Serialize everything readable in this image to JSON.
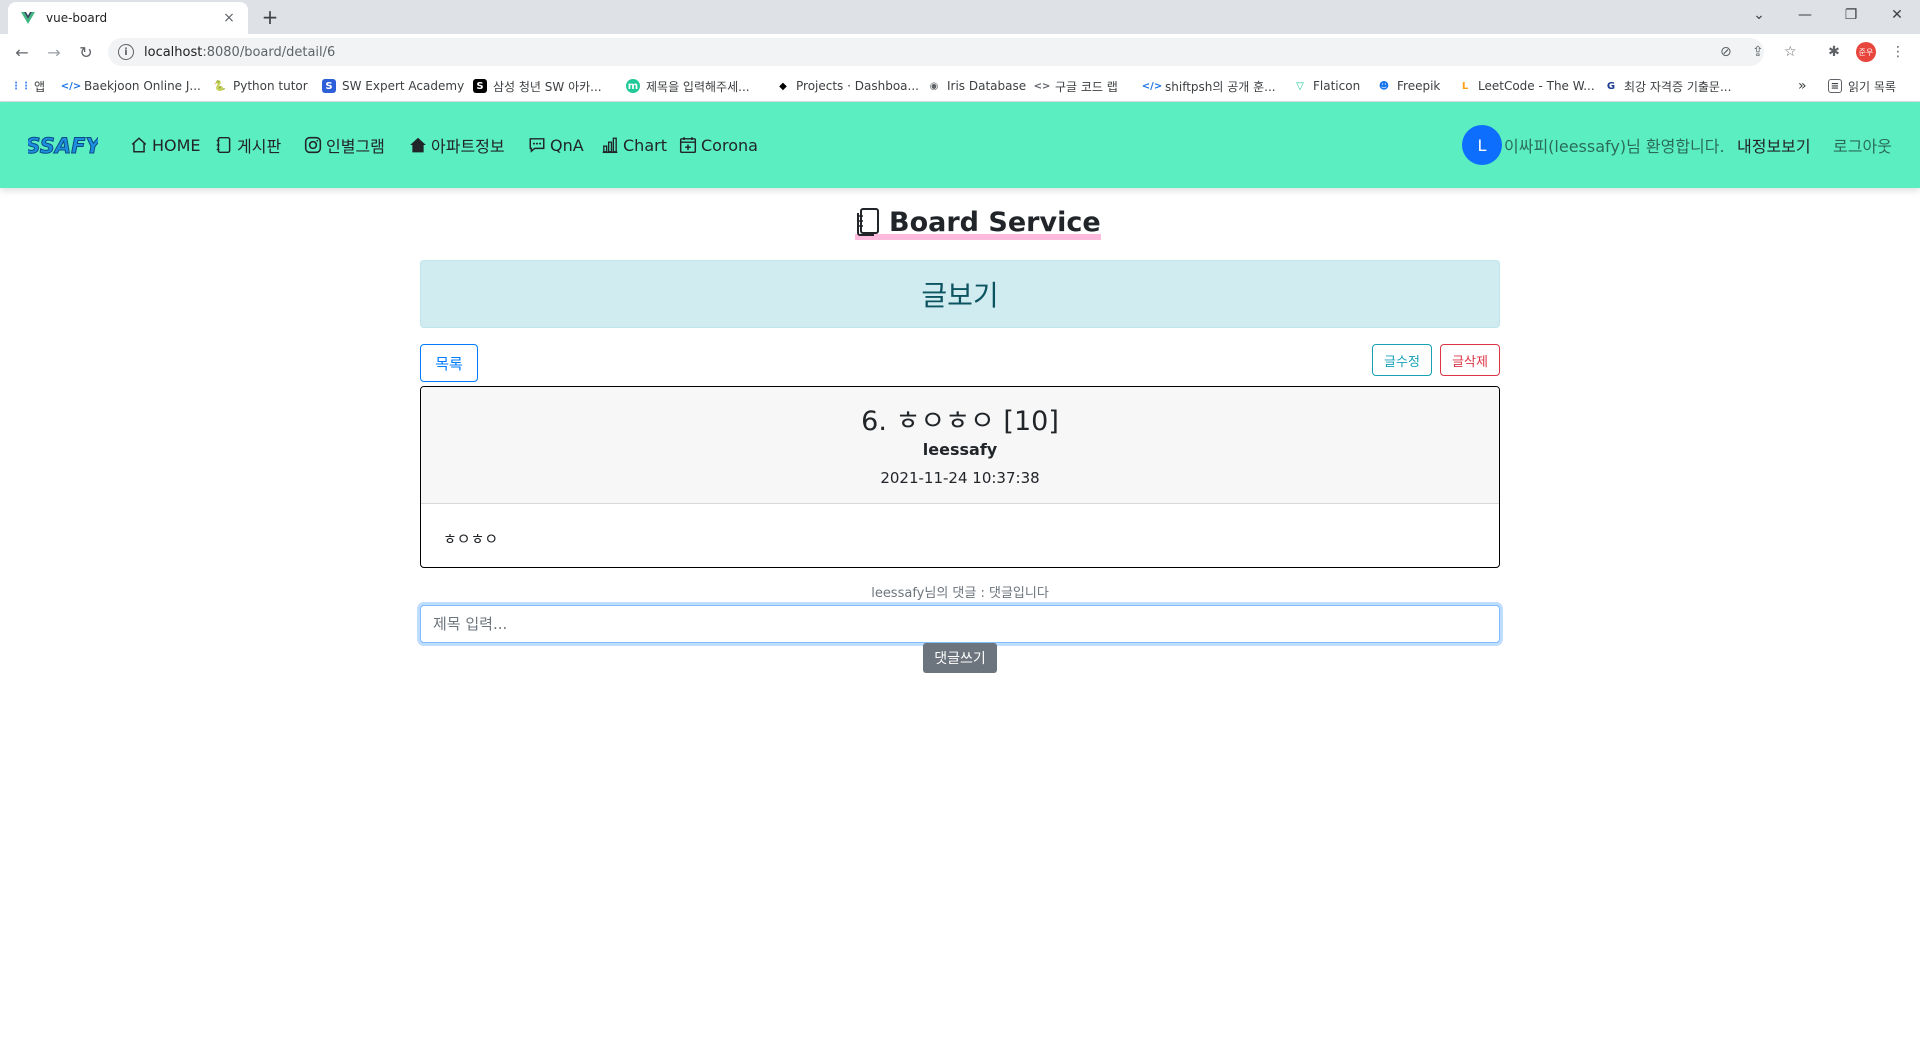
{
  "browser": {
    "tab_title": "vue-board",
    "tab_close": "×",
    "new_tab": "+",
    "url_host": "localhost",
    "url_rest": ":8080/board/detail/6",
    "profile_initials": "준우",
    "bookmarks": [
      {
        "label": "앱",
        "icon": "apps-icon",
        "color": "#4285f4"
      },
      {
        "label": "Baekjoon Online J...",
        "icon": "code-icon",
        "color": "#1a73e8"
      },
      {
        "label": "Python tutor",
        "icon": "python-icon",
        "color": "#3776ab"
      },
      {
        "label": "SW Expert Academy",
        "icon": "swea-icon",
        "color": "#2d5fd8"
      },
      {
        "label": "삼성 청년 SW 아카...",
        "icon": "ssafy-icon",
        "color": "#000000"
      },
      {
        "label": "제목을 입력해주세...",
        "icon": "m-icon",
        "color": "#20c997"
      },
      {
        "label": "Projects · Dashboa...",
        "icon": "gitlab-icon",
        "color": "#000000"
      },
      {
        "label": "Iris Database",
        "icon": "globe-icon",
        "color": "#5f6368"
      },
      {
        "label": "구글 코드 랩",
        "icon": "codelab-icon",
        "color": "#5f6368"
      },
      {
        "label": "shiftpsh의 공개 훈...",
        "icon": "code-icon",
        "color": "#1a73e8"
      },
      {
        "label": "Flaticon",
        "icon": "flaticon-icon",
        "color": "#1fc59a"
      },
      {
        "label": "Freepik",
        "icon": "freepik-icon",
        "color": "#1273eb"
      },
      {
        "label": "LeetCode - The W...",
        "icon": "leetcode-icon",
        "color": "#ffa116"
      },
      {
        "label": "최강 자격증 기출문...",
        "icon": "gsc-icon",
        "color": "#1a3a8e"
      }
    ],
    "reading_list": "읽기 목록",
    "overflow": "»"
  },
  "navbar": {
    "items": [
      {
        "label": "HOME",
        "icon": "house-icon"
      },
      {
        "label": "게시판",
        "icon": "journal-icon"
      },
      {
        "label": "인별그램",
        "icon": "instagram-icon"
      },
      {
        "label": "아파트정보",
        "icon": "house-fill-icon"
      },
      {
        "label": "QnA",
        "icon": "chat-dots-icon"
      },
      {
        "label": "Chart",
        "icon": "bar-chart-icon"
      },
      {
        "label": "Corona",
        "icon": "calendar-plus-icon"
      }
    ],
    "avatar_letter": "L",
    "welcome": "이싸피(leessafy)님 환영합니다.",
    "mypage": "내정보보기",
    "logout": "로그아웃",
    "bg_color": "#5beec0"
  },
  "main": {
    "page_title": "Board Service",
    "section_title": "글보기",
    "btn_list": "목록",
    "btn_edit": "글수정",
    "btn_delete": "글삭제",
    "post": {
      "title": "6. ㅎㅇㅎㅇ [10]",
      "author": "leessafy",
      "date": "2021-11-24 10:37:38",
      "content": "ㅎㅇㅎㅇ"
    },
    "comment_line": "leessafy님의 댓글 : 댓글입니다",
    "comment_placeholder": "제목 입력...",
    "btn_comment": "댓글쓰기"
  }
}
